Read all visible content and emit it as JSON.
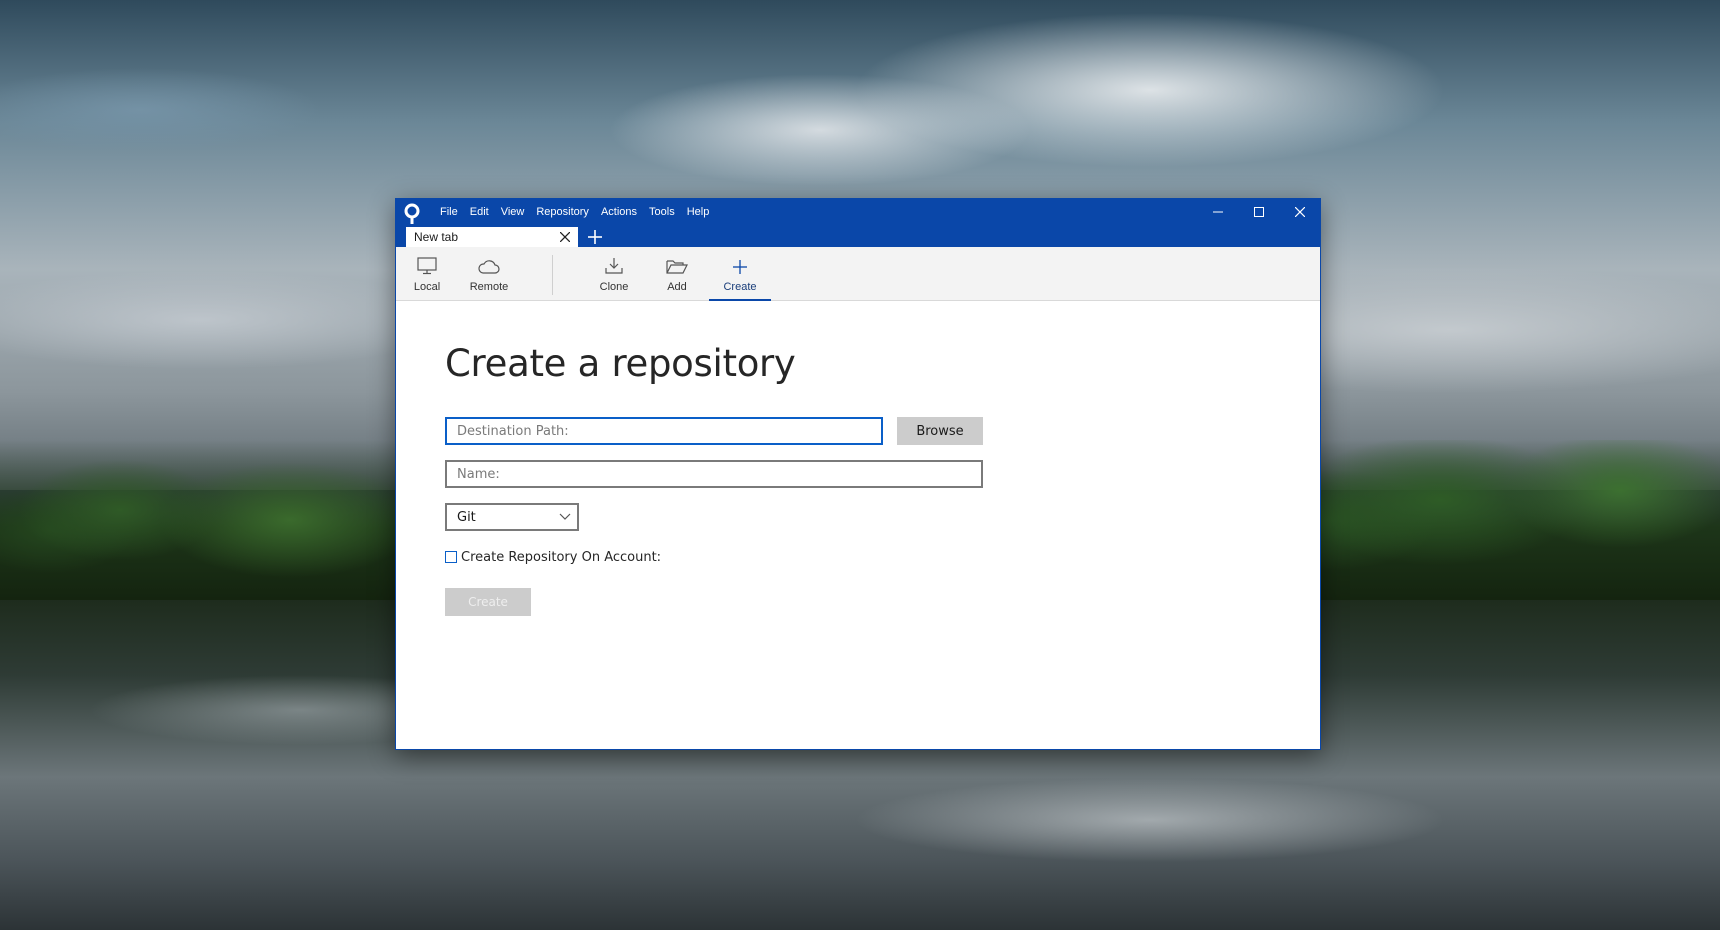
{
  "window": {
    "menu": [
      "File",
      "Edit",
      "View",
      "Repository",
      "Actions",
      "Tools",
      "Help"
    ],
    "tab_label": "New tab"
  },
  "toolbar": {
    "local_label": "Local",
    "remote_label": "Remote",
    "clone_label": "Clone",
    "add_label": "Add",
    "create_label": "Create",
    "active_tool": "Create"
  },
  "form": {
    "title": "Create a repository",
    "destination_placeholder": "Destination Path:",
    "destination_value": "",
    "browse_label": "Browse",
    "name_placeholder": "Name:",
    "name_value": "",
    "vcs_selected": "Git",
    "account_checkbox_label": "Create Repository On Account:",
    "account_checkbox_checked": false,
    "create_button_label": "Create"
  },
  "colors": {
    "titlebar": "#0a47a9",
    "accent": "#0a5fc8",
    "disabled_button": "#cccccc"
  },
  "icons": {
    "app": "sourcetree-logo-icon",
    "local": "monitor-icon",
    "remote": "cloud-icon",
    "clone": "download-icon",
    "add": "folder-open-icon",
    "create": "plus-icon"
  }
}
